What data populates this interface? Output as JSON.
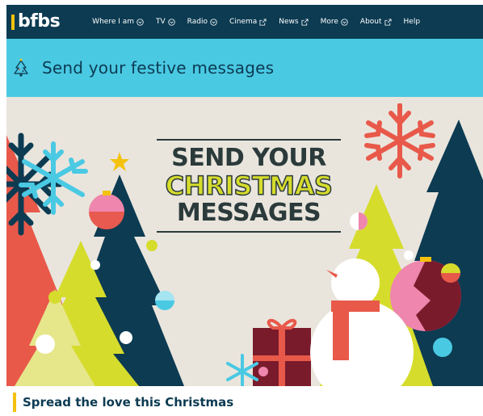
{
  "brand": {
    "logo_text": "bfbs",
    "accent_color": "#f4c20d",
    "nav_bg": "#0c3b52",
    "header_bg": "#4ac9e3"
  },
  "nav": [
    {
      "label": "Where I am",
      "icon": "chevron-circle-icon"
    },
    {
      "label": "TV",
      "icon": "chevron-circle-icon"
    },
    {
      "label": "Radio",
      "icon": "chevron-circle-icon"
    },
    {
      "label": "Cinema",
      "icon": "external-link-icon"
    },
    {
      "label": "News",
      "icon": "external-link-icon"
    },
    {
      "label": "More",
      "icon": "chevron-circle-icon"
    },
    {
      "label": "About",
      "icon": "external-link-icon"
    },
    {
      "label": "Help",
      "icon": ""
    }
  ],
  "section": {
    "title": "Send your festive messages",
    "icon": "christmas-tree-icon"
  },
  "hero": {
    "line1": "SEND YOUR",
    "line2": "CHRISTMAS",
    "line3": "MESSAGES"
  },
  "subsection": {
    "heading": "Spread the love this Christmas"
  }
}
